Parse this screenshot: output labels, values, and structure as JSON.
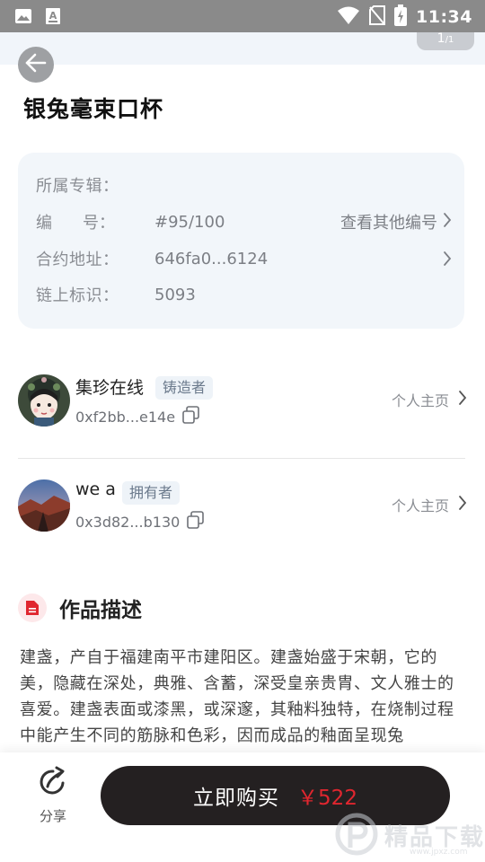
{
  "status_bar": {
    "time": "11:34",
    "icons": [
      "image-icon",
      "text-a-icon",
      "wifi-icon",
      "no-sim-icon",
      "battery-charging-icon"
    ]
  },
  "pager": {
    "current": "1",
    "total": "/1"
  },
  "product": {
    "title": "银兔毫束口杯"
  },
  "info": {
    "album_label": "所属专辑：",
    "number_label_a": "编",
    "number_label_b": "号：",
    "number_value": "#95/100",
    "number_link": "查看其他编号",
    "contract_label": "合约地址：",
    "contract_value": "646fa0...6124",
    "chain_label": "链上标识：",
    "chain_value": "5093"
  },
  "creator": {
    "name": "集珍在线",
    "role": "铸造者",
    "address": "0xf2bb...e14e",
    "homepage": "个人主页"
  },
  "owner": {
    "name": "we a",
    "role": "拥有者",
    "address": "0x3d82...b130",
    "homepage": "个人主页"
  },
  "description": {
    "heading": "作品描述",
    "text": "建盏，产自于福建南平市建阳区。建盏始盛于宋朝，它的美，隐藏在深处，典雅、含蓄，深受皇亲贵胄、文人雅士的喜爱。建盏表面或漆黑，或深邃，其釉料独特，在烧制过程中能产生不同的筋脉和色彩，因而成品的釉面呈现兔"
  },
  "bottom": {
    "share_label": "分享",
    "buy_label": "立即购买",
    "price": "￥522"
  },
  "watermark": {
    "text": "精品下载",
    "url": "www.jpxz.com"
  },
  "colors": {
    "accent_red": "#e0262f",
    "buy_button": "#242021",
    "card_bg": "#f2f6fa"
  }
}
